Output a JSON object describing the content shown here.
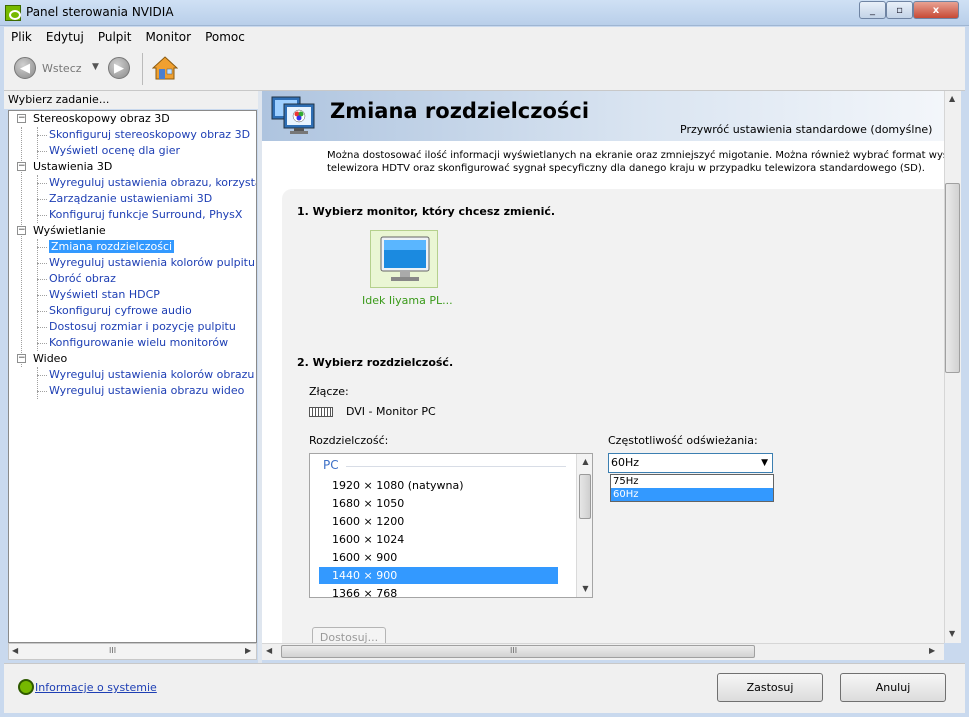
{
  "window": {
    "title": "Panel sterowania NVIDIA",
    "close_glyph": "x",
    "min_glyph": "_",
    "max_glyph": "▫"
  },
  "menu": [
    "Plik",
    "Edytuj",
    "Pulpit",
    "Monitor",
    "Pomoc"
  ],
  "toolbar": {
    "back_label": "Wstecz",
    "back_glyph": "◀",
    "forward_glyph": "▶",
    "dropdown_glyph": "▼"
  },
  "left": {
    "heading": "Wybierz zadanie...",
    "tree": [
      {
        "type": "cat",
        "label": "Stereoskopowy obraz 3D"
      },
      {
        "type": "link",
        "label": "Skonfiguruj stereoskopowy obraz 3D"
      },
      {
        "type": "link",
        "label": "Wyświetl ocenę dla gier"
      },
      {
        "type": "cat",
        "label": "Ustawienia 3D"
      },
      {
        "type": "link",
        "label": "Wyreguluj ustawienia obrazu, korzystając z podglądu"
      },
      {
        "type": "link",
        "label": "Zarządzanie ustawieniami 3D"
      },
      {
        "type": "link",
        "label": "Konfiguruj funkcje Surround, PhysX"
      },
      {
        "type": "cat",
        "label": "Wyświetlanie"
      },
      {
        "type": "link",
        "label": "Zmiana rozdzielczości",
        "selected": true
      },
      {
        "type": "link",
        "label": "Wyreguluj ustawienia kolorów pulpitu"
      },
      {
        "type": "link",
        "label": "Obróć obraz"
      },
      {
        "type": "link",
        "label": "Wyświetl stan HDCP"
      },
      {
        "type": "link",
        "label": "Skonfiguruj cyfrowe audio"
      },
      {
        "type": "link",
        "label": "Dostosuj rozmiar i pozycję pulpitu"
      },
      {
        "type": "link",
        "label": "Konfigurowanie wielu monitorów"
      },
      {
        "type": "cat",
        "label": "Wideo"
      },
      {
        "type": "link",
        "label": "Wyreguluj ustawienia kolorów obrazu wideo"
      },
      {
        "type": "link",
        "label": "Wyreguluj ustawienia obrazu wideo"
      }
    ],
    "expander_glyph": "−",
    "scroll_left": "◀",
    "scroll_right": "▶",
    "scroll_grip": "III"
  },
  "page": {
    "title": "Zmiana rozdzielczości",
    "restore_defaults": "Przywróć ustawienia standardowe (domyślne)",
    "intro_line1": "Można dostosować ilość informacji wyświetlanych na ekranie oraz zmniejszyć migotanie. Można również wybrać format wysokiej rozdzielczości",
    "intro_line2": "telewizora HDTV oraz skonfigurować sygnał specyficzny dla danego kraju w przypadku telewizora standardowego (SD).",
    "step1": "1. Wybierz monitor, który chcesz zmienić.",
    "monitor_name": "Idek Iiyama PL...",
    "step2": "2. Wybierz rozdzielczość.",
    "connector_label": "Złącze:",
    "connector_value": "DVI - Monitor PC",
    "resolution_label": "Rozdzielczość:",
    "resolution_group": "PC",
    "resolutions": [
      "1920 × 1080 (natywna)",
      "1680 × 1050",
      "1600 × 1200",
      "1600 × 1024",
      "1600 × 900",
      "1440 × 900",
      "1366 × 768"
    ],
    "selected_resolution_index": 5,
    "refresh_label": "Częstotliwość odświeżania:",
    "refresh_value": "60Hz",
    "refresh_options": [
      "75Hz",
      "60Hz"
    ],
    "refresh_selected_index": 1,
    "adjust_button": "Dostosuj...",
    "scroll_up": "▲",
    "scroll_down": "▼",
    "scroll_grip": "III",
    "dropdown_arrow": "▼"
  },
  "footer": {
    "sysinfo": "Informacje o systemie",
    "apply": "Zastosuj",
    "cancel": "Anuluj"
  },
  "colors": {
    "nvidia_green": "#76b900",
    "selection": "#3399ff",
    "link": "#1e3fb4"
  }
}
